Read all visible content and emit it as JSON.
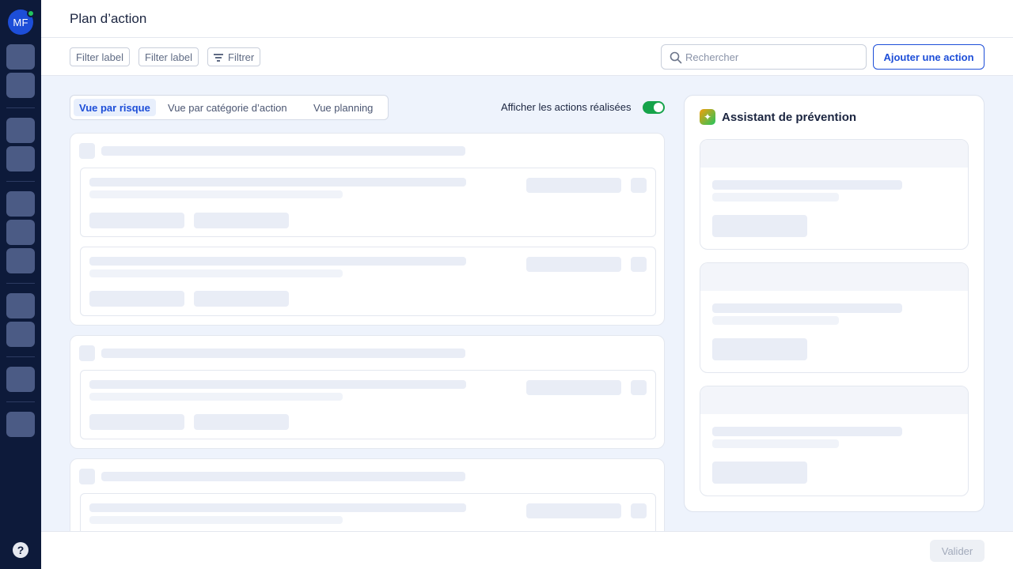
{
  "sidebar": {
    "avatar_initials": "MF",
    "status": "online",
    "help_label": "?"
  },
  "header": {
    "title": "Plan d’action"
  },
  "toolbar": {
    "filters": [
      "Filter label",
      "Filter label"
    ],
    "filter_button_label": "Filtrer",
    "search_placeholder": "Rechercher",
    "search_value": "",
    "add_button_label": "Ajouter une action"
  },
  "view": {
    "tabs": [
      {
        "label": "Vue par risque",
        "active": true
      },
      {
        "label": "Vue par catégorie d’action",
        "active": false
      },
      {
        "label": "Vue planning",
        "active": false
      }
    ],
    "toggle_label": "Afficher les actions réalisées",
    "toggle_on": true
  },
  "assistant": {
    "title": "Assistant de prévention",
    "icon": "sparkle-icon"
  },
  "footer": {
    "validate_label": "Valider",
    "validate_disabled": true
  },
  "colors": {
    "sidebar_bg": "#0d1a3a",
    "accent": "#1d4ed8",
    "toggle_on": "#16a34a",
    "main_bg": "#eef3fc"
  }
}
